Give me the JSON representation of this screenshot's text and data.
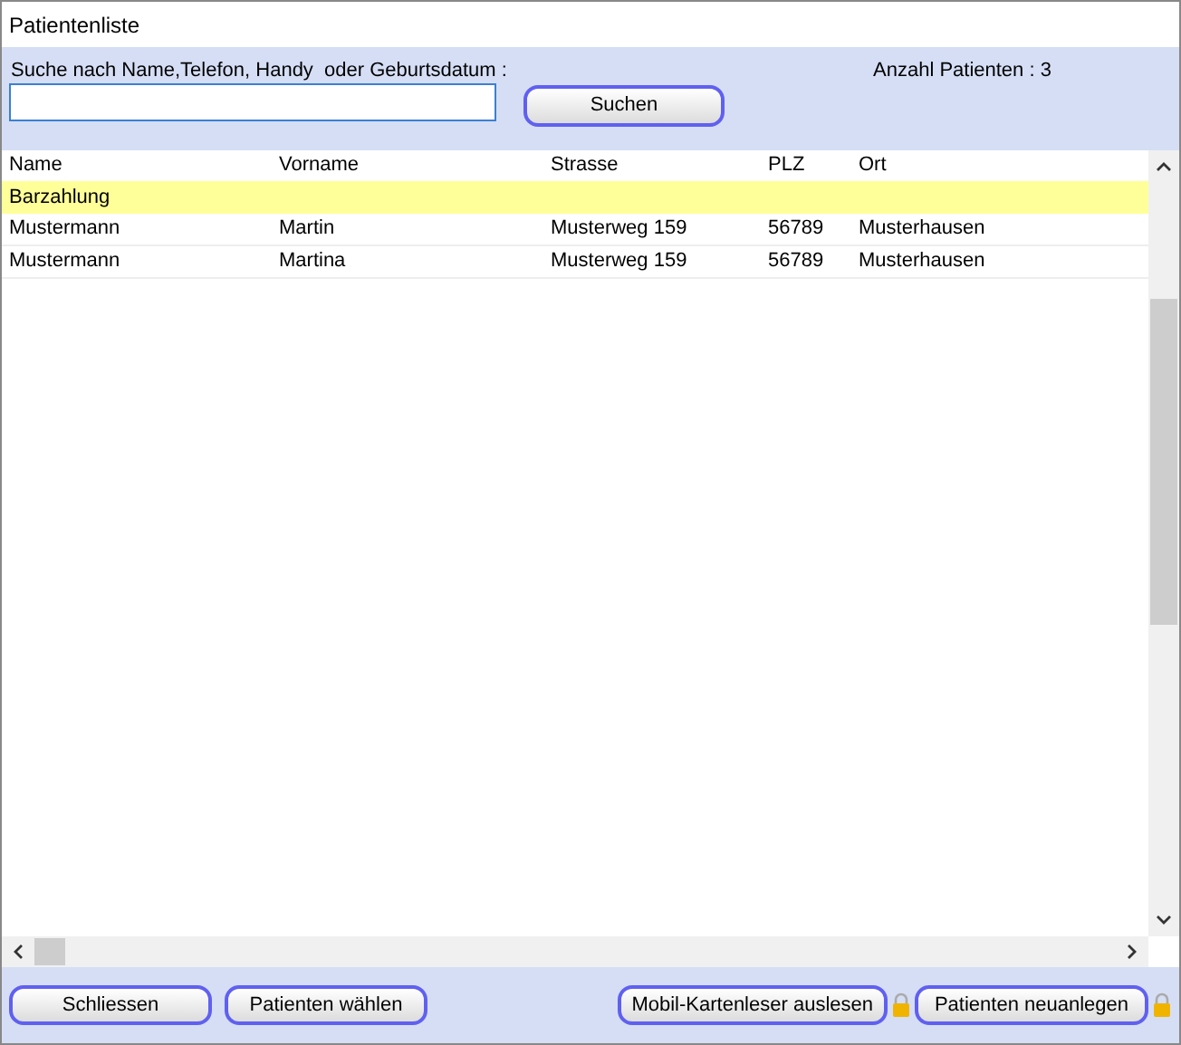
{
  "window": {
    "title": "Patientenliste"
  },
  "search": {
    "label": "Suche nach Name,Telefon, Handy  oder Geburtsdatum :",
    "button": "Suchen",
    "count": "Anzahl Patienten : 3"
  },
  "table": {
    "columns": [
      "Name",
      "Vorname",
      "Strasse",
      "PLZ",
      "Ort"
    ],
    "rows": [
      {
        "kind": "group",
        "cells": [
          "Barzahlung"
        ]
      },
      {
        "kind": "data",
        "cells": [
          "Mustermann",
          "Martin",
          "Musterweg 159",
          "56789",
          "Musterhausen"
        ]
      },
      {
        "kind": "data",
        "cells": [
          "Mustermann",
          "Martina",
          "Musterweg 159",
          "56789",
          "Musterhausen"
        ]
      }
    ]
  },
  "buttons_left": [
    {
      "label": "Schliessen",
      "locked": false
    },
    {
      "label": "Patienten wählen",
      "locked": false
    }
  ],
  "buttons_right": [
    {
      "label": "Mobil-Kartenleser auslesen",
      "locked": true
    },
    {
      "label": "Patienten neuanlegen",
      "locked": true
    }
  ]
}
